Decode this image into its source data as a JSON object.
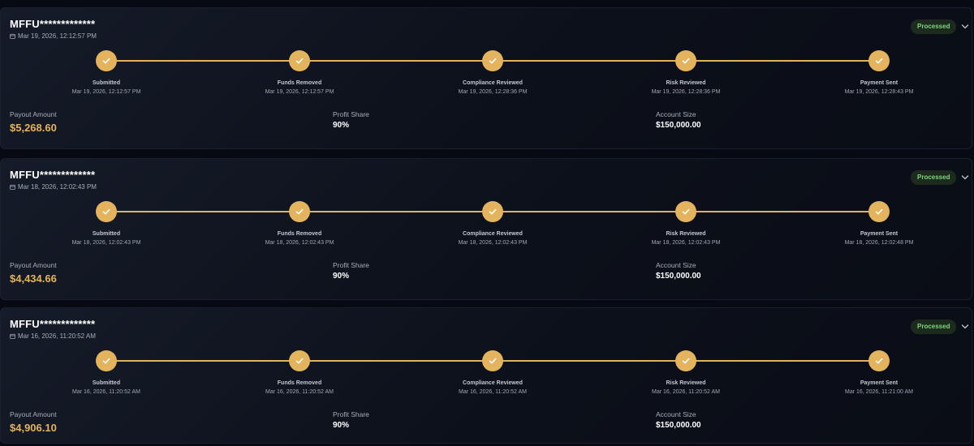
{
  "payouts": [
    {
      "account": "MFFU*************",
      "date": "Mar 19, 2026, 12:12:57 PM",
      "status": "Processed",
      "steps": [
        {
          "label": "Submitted",
          "time": "Mar 19, 2026, 12:12:57 PM"
        },
        {
          "label": "Funds Removed",
          "time": "Mar 19, 2026, 12:12:57 PM"
        },
        {
          "label": "Compliance Reviewed",
          "time": "Mar 19, 2026, 12:28:36 PM"
        },
        {
          "label": "Risk Reviewed",
          "time": "Mar 19, 2026, 12:28:36 PM"
        },
        {
          "label": "Payment Sent",
          "time": "Mar 19, 2026, 12:28:43 PM"
        }
      ],
      "payout_amount_label": "Payout Amount",
      "payout_amount": "$5,268.60",
      "profit_share_label": "Profit Share",
      "profit_share": "90%",
      "account_size_label": "Account Size",
      "account_size": "$150,000.00"
    },
    {
      "account": "MFFU*************",
      "date": "Mar 18, 2026, 12:02:43 PM",
      "status": "Processed",
      "steps": [
        {
          "label": "Submitted",
          "time": "Mar 18, 2026, 12:02:43 PM"
        },
        {
          "label": "Funds Removed",
          "time": "Mar 18, 2026, 12:02:43 PM"
        },
        {
          "label": "Compliance Reviewed",
          "time": "Mar 18, 2026, 12:02:43 PM"
        },
        {
          "label": "Risk Reviewed",
          "time": "Mar 18, 2026, 12:02:43 PM"
        },
        {
          "label": "Payment Sent",
          "time": "Mar 18, 2026, 12:02:48 PM"
        }
      ],
      "payout_amount_label": "Payout Amount",
      "payout_amount": "$4,434.66",
      "profit_share_label": "Profit Share",
      "profit_share": "90%",
      "account_size_label": "Account Size",
      "account_size": "$150,000.00"
    },
    {
      "account": "MFFU*************",
      "date": "Mar 16, 2026, 11:20:52 AM",
      "status": "Processed",
      "steps": [
        {
          "label": "Submitted",
          "time": "Mar 16, 2026, 11:20:52 AM"
        },
        {
          "label": "Funds Removed",
          "time": "Mar 16, 2026, 11:20:52 AM"
        },
        {
          "label": "Compliance Reviewed",
          "time": "Mar 16, 2026, 11:20:52 AM"
        },
        {
          "label": "Risk Reviewed",
          "time": "Mar 16, 2026, 11:20:52 AM"
        },
        {
          "label": "Payment Sent",
          "time": "Mar 16, 2026, 11:21:00 AM"
        }
      ],
      "payout_amount_label": "Payout Amount",
      "payout_amount": "$4,906.10",
      "profit_share_label": "Profit Share",
      "profit_share": "90%",
      "account_size_label": "Account Size",
      "account_size": "$150,000.00"
    }
  ],
  "icons": {
    "step": "check-icon",
    "date": "calendar-icon",
    "toggle": "chevron-down-icon"
  },
  "colors": {
    "accent": "#e3b35d",
    "status_text": "#7ed77f",
    "status_bg": "#1d2a1e",
    "background": "#070a12"
  }
}
